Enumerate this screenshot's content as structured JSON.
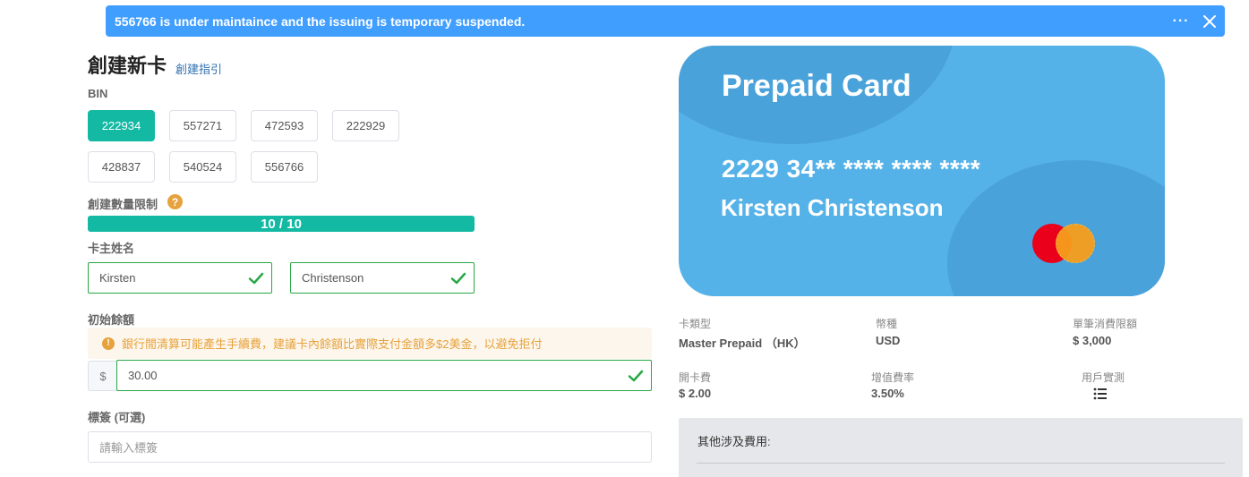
{
  "banner": {
    "message": "556766 is under maintaince and the issuing is temporary suspended.",
    "more_label": "···"
  },
  "form": {
    "title": "創建新卡",
    "guide_link": "創建指引",
    "bin_label": "BIN",
    "bins": [
      "222934",
      "557271",
      "472593",
      "222929",
      "428837",
      "540524",
      "556766"
    ],
    "selected_bin": "222934",
    "limit_label": "創建數量限制",
    "limit_help": "?",
    "limit_progress": "10 / 10",
    "limit_fraction": 1.0,
    "holder_label": "卡主姓名",
    "first_name": "Kirsten",
    "last_name": "Christenson",
    "balance_label": "初始餘額",
    "warning_text": "銀行閒清算可能產生手續費，建議卡內餘額比實際支付金額多$2美金，以避免拒付",
    "currency_symbol": "$",
    "amount": "30.00",
    "tag_label": "標簽 (可選)",
    "tag_placeholder": "請輸入標簽"
  },
  "card": {
    "title": "Prepaid Card",
    "number": "2229 34** **** **** ****",
    "holder": "Kirsten Christenson"
  },
  "info": {
    "card_type_label": "卡類型",
    "card_type_value": "Master Prepaid （HK）",
    "currency_label": "幣種",
    "currency_value": "USD",
    "limit_label": "單筆消費限額",
    "limit_value": "$ 3,000",
    "open_fee_label": "開卡費",
    "open_fee_value": "$ 2.00",
    "topup_rate_label": "增值費率",
    "topup_rate_value": "3.50%",
    "user_test_label": "用戶實測"
  },
  "fees": {
    "title": "其他涉及費用:"
  },
  "colors": {
    "banner": "#409eff",
    "accent": "#13b9a3",
    "valid": "#28a745",
    "warning": "#e6a23c",
    "card": "#55b2e8"
  }
}
